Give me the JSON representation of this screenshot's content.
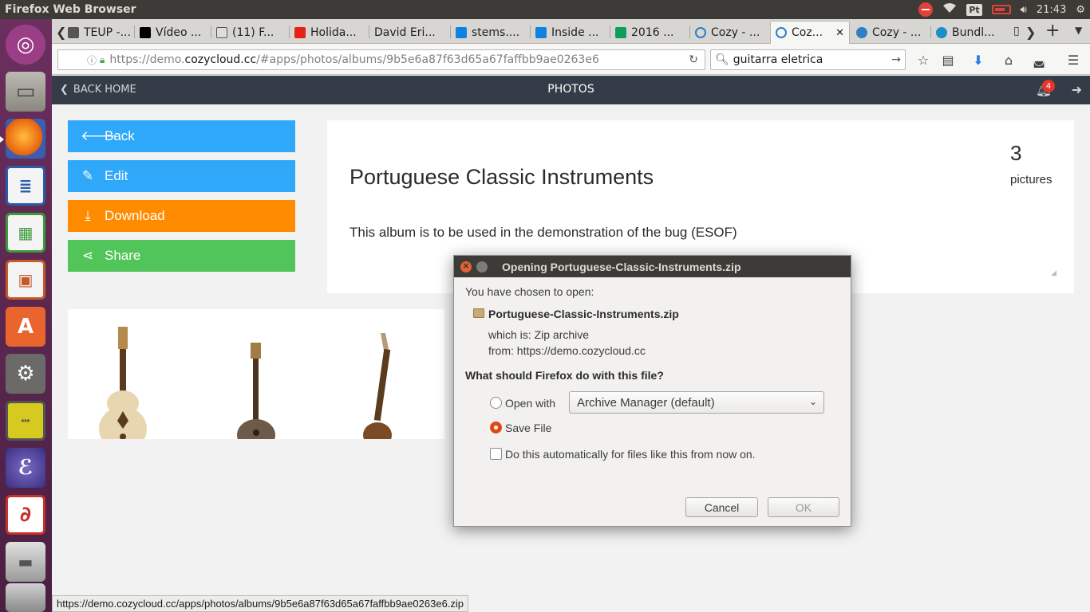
{
  "system_bar": {
    "title": "Firefox Web Browser",
    "keyboard": "Pt",
    "time": "21:43"
  },
  "launcher": {
    "icons": [
      "ubuntu-dash-icon",
      "files-icon",
      "firefox-icon",
      "writer-icon",
      "calc-icon",
      "impress-icon",
      "software-center-icon",
      "system-settings-icon",
      "ruler-icon",
      "emacs-icon",
      "pdf-reader-icon",
      "drive-icon",
      "trash-icon"
    ]
  },
  "tabs": [
    {
      "label": "TEUP -..."
    },
    {
      "label": "Vídeo ..."
    },
    {
      "label": "(11) F..."
    },
    {
      "label": "Holida..."
    },
    {
      "label": "David Eri..."
    },
    {
      "label": "stems...."
    },
    {
      "label": "Inside ..."
    },
    {
      "label": "2016 ..."
    },
    {
      "label": "Cozy - ..."
    },
    {
      "label": "Coz..."
    },
    {
      "label": "Cozy - ..."
    },
    {
      "label": "Bundl..."
    }
  ],
  "url": {
    "prefix": "https://demo.",
    "host": "cozycloud.cc",
    "path": "/#apps/photos/albums/9b5e6a87f63d65a67faffbb9ae0263e6"
  },
  "search": {
    "value": "guitarra eletrica"
  },
  "cozy_bar": {
    "back_label": "BACK HOME",
    "title": "PHOTOS",
    "notifications": "4"
  },
  "actions": {
    "back": "Back",
    "edit": "Edit",
    "download": "Download",
    "share": "Share"
  },
  "album": {
    "name": "Portuguese Classic Instruments",
    "description": "This album is to be used in the demonstration of the bug (ESOF)",
    "count": "3",
    "count_label": "pictures"
  },
  "status_url": "https://demo.cozycloud.cc/apps/photos/albums/9b5e6a87f63d65a67faffbb9ae0263e6.zip",
  "dialog": {
    "title": "Opening Portuguese-Classic-Instruments.zip",
    "intro": "You have chosen to open:",
    "filename": "Portuguese-Classic-Instruments.zip",
    "which_is_label": "which is:",
    "which_is_value": "Zip archive",
    "from_label": "from:",
    "from_value": "https://demo.cozycloud.cc",
    "question": "What should Firefox do with this file?",
    "open_with_label": "Open with",
    "open_with_app": "Archive Manager (default)",
    "save_file_label": "Save File",
    "auto_label": "Do this automatically for files like this from now on.",
    "selected": "save",
    "cancel": "Cancel",
    "ok": "OK"
  },
  "colors": {
    "back": "#2fa8f9",
    "edit": "#2fa8f9",
    "download": "#ff8c00",
    "share": "#51c55a",
    "cozy_bar": "#343d47"
  }
}
